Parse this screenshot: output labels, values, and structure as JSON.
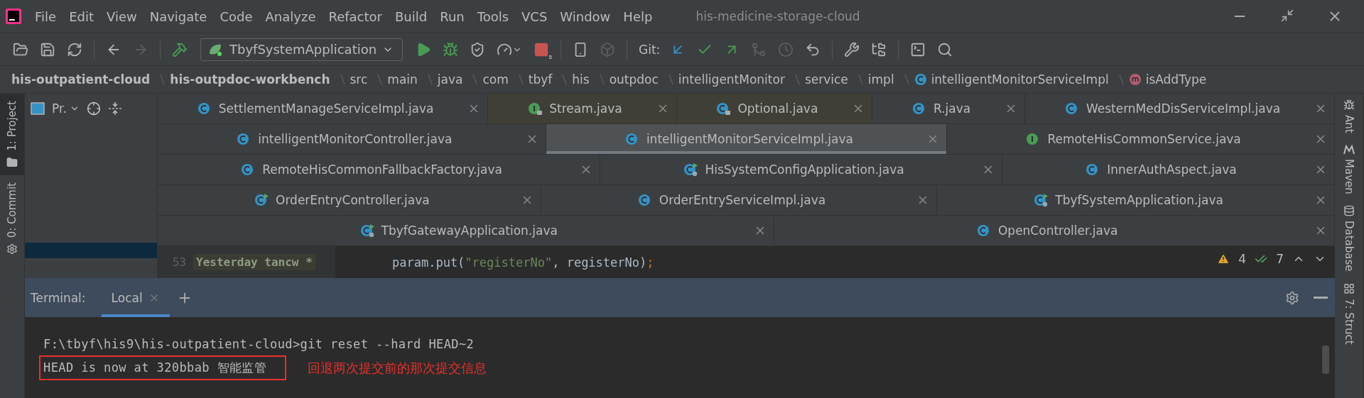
{
  "menu_bar": {
    "items": [
      "File",
      "Edit",
      "View",
      "Navigate",
      "Code",
      "Analyze",
      "Refactor",
      "Build",
      "Run",
      "Tools",
      "VCS",
      "Window",
      "Help"
    ],
    "project_title": "his-medicine-storage-cloud"
  },
  "toolbar": {
    "left": [
      {
        "kind": "open",
        "disabled": false
      },
      {
        "kind": "save",
        "disabled": false
      },
      {
        "kind": "sync",
        "disabled": false
      },
      {
        "kind": "back",
        "disabled": false
      },
      {
        "kind": "forward",
        "disabled": true
      },
      {
        "kind": "build",
        "disabled": false
      }
    ],
    "run_config": "TbyfSystemApplication",
    "run": [
      {
        "kind": "run",
        "disabled": false
      },
      {
        "kind": "debug",
        "disabled": false
      },
      {
        "kind": "coverage",
        "disabled": false
      },
      {
        "kind": "profile",
        "disabled": false
      },
      {
        "kind": "stop",
        "disabled": false
      },
      {
        "kind": "device",
        "disabled": false
      },
      {
        "kind": "sdk",
        "disabled": true
      }
    ],
    "stop_count": "5",
    "vcs_label": "Git:",
    "vcs": [
      {
        "kind": "update",
        "disabled": false
      },
      {
        "kind": "commit",
        "disabled": false
      },
      {
        "kind": "push",
        "disabled": false
      },
      {
        "kind": "merge",
        "disabled": true
      },
      {
        "kind": "history",
        "disabled": true
      },
      {
        "kind": "rollback",
        "disabled": false
      }
    ],
    "tools": [
      {
        "kind": "settings",
        "disabled": false
      },
      {
        "kind": "structure",
        "disabled": false
      },
      {
        "kind": "terminal",
        "disabled": false
      },
      {
        "kind": "search",
        "disabled": false
      }
    ]
  },
  "breadcrumbs": [
    {
      "label": "his-outpatient-cloud",
      "kind": "module"
    },
    {
      "label": "his-outpdoc-workbench",
      "kind": "module"
    },
    {
      "label": "src",
      "kind": "folder"
    },
    {
      "label": "main",
      "kind": "folder"
    },
    {
      "label": "java",
      "kind": "folder"
    },
    {
      "label": "com",
      "kind": "folder"
    },
    {
      "label": "tbyf",
      "kind": "folder"
    },
    {
      "label": "his",
      "kind": "folder"
    },
    {
      "label": "outpdoc",
      "kind": "folder"
    },
    {
      "label": "intelligentMonitor",
      "kind": "folder"
    },
    {
      "label": "service",
      "kind": "folder"
    },
    {
      "label": "impl",
      "kind": "folder"
    },
    {
      "label": "intelligentMonitorServiceImpl",
      "kind": "class"
    },
    {
      "label": "isAddType",
      "kind": "method"
    }
  ],
  "left_stripe": [
    {
      "label": "1: Project",
      "selected": true
    },
    {
      "label": "0: Commit",
      "selected": false
    }
  ],
  "project_panel": {
    "title": "Pr."
  },
  "editor_tabs": [
    [
      {
        "name": "SettlementManageServiceImpl.java",
        "kind": "class",
        "locked": false,
        "selected": false
      },
      {
        "name": "Stream.java",
        "kind": "interface",
        "locked": true,
        "selected": false
      },
      {
        "name": "Optional.java",
        "kind": "class",
        "locked": true,
        "selected": false
      },
      {
        "name": "R.java",
        "kind": "class",
        "locked": false,
        "selected": false
      },
      {
        "name": "WesternMedDisServiceImpl.java",
        "kind": "class",
        "locked": false,
        "selected": false
      }
    ],
    [
      {
        "name": "intelligentMonitorController.java",
        "kind": "class",
        "locked": false,
        "selected": false
      },
      {
        "name": "intelligentMonitorServiceImpl.java",
        "kind": "class",
        "locked": false,
        "selected": true
      },
      {
        "name": "RemoteHisCommonService.java",
        "kind": "interface",
        "locked": false,
        "selected": false
      }
    ],
    [
      {
        "name": "RemoteHisCommonFallbackFactory.java",
        "kind": "class",
        "locked": false,
        "selected": false
      },
      {
        "name": "HisSystemConfigApplication.java",
        "kind": "app",
        "locked": false,
        "selected": false
      },
      {
        "name": "InnerAuthAspect.java",
        "kind": "class",
        "locked": false,
        "selected": false
      }
    ],
    [
      {
        "name": "OrderEntryController.java",
        "kind": "controller",
        "locked": false,
        "selected": false
      },
      {
        "name": "OrderEntryServiceImpl.java",
        "kind": "class",
        "locked": false,
        "selected": false
      },
      {
        "name": "TbyfSystemApplication.java",
        "kind": "app",
        "locked": false,
        "selected": false
      }
    ],
    [
      {
        "name": "TbyfGatewayApplication.java",
        "kind": "app",
        "locked": false,
        "selected": false
      },
      {
        "name": "OpenController.java",
        "kind": "class",
        "locked": false,
        "selected": false
      }
    ]
  ],
  "code": {
    "lines": [
      {
        "number": "53",
        "annotation": "Yesterday tancw *",
        "tokens": [
          {
            "text": "param.put(",
            "kind": "plain"
          },
          {
            "text": "\"registerNo\"",
            "kind": "string"
          },
          {
            "text": ", registerNo)",
            "kind": "plain"
          },
          {
            "text": ";",
            "kind": "punct"
          }
        ]
      }
    ]
  },
  "inspections": {
    "warnings": "4",
    "weak_warnings": "7"
  },
  "right_stripe": [
    "Ant",
    "Maven",
    "Database",
    "7: Struct"
  ],
  "terminal": {
    "label": "Terminal:",
    "tabs": [
      {
        "label": "Local",
        "selected": true
      }
    ],
    "lines": [
      {
        "text": "F:\\tbyf\\his9\\his-outpatient-cloud>git reset --hard HEAD~2",
        "boxed": false
      },
      {
        "text": "HEAD is now at 320bbab 智能监管",
        "boxed": true
      }
    ],
    "annotation": "回退两次提交前的那次提交信息"
  }
}
